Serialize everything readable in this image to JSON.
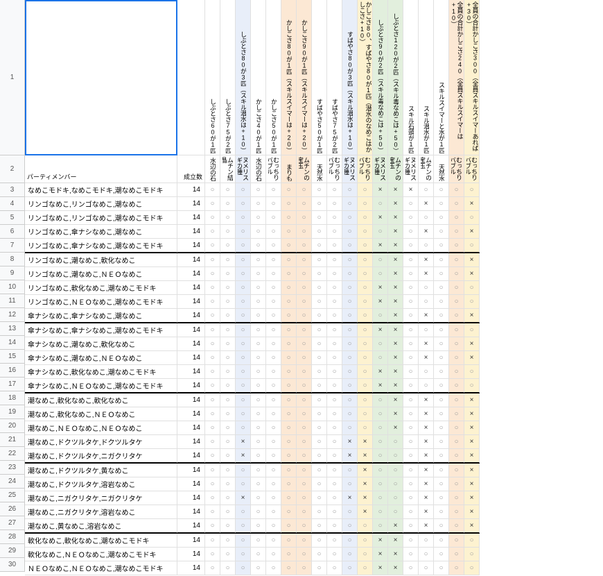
{
  "row1_label": "1",
  "row2_label": "2",
  "headers": [
    {
      "label": "パーティメンバー",
      "w": "w-party",
      "bg": 0
    },
    {
      "label": "成立数",
      "w": "w-count",
      "bg": 0
    },
    {
      "label": "しぶとさ60が1匹",
      "w": "w-s",
      "bg": 0
    },
    {
      "label": "しぶとさ75が2匹",
      "w": "w-s",
      "bg": 0
    },
    {
      "label": "しぶとさ80が3匹（スキル潜水は+10）",
      "w": "w-s",
      "bg": 1
    },
    {
      "label": "かしこさ40が1匹",
      "w": "w-s",
      "bg": 0
    },
    {
      "label": "かしこさ50が1匹",
      "w": "w-s",
      "bg": 0
    },
    {
      "label": "かしこさ80が1匹（スキルスイマーは+20）",
      "w": "w-s",
      "bg": 2
    },
    {
      "label": "かしこさ90が1匹（スキルスイマーは+20）",
      "w": "w-s",
      "bg": 2
    },
    {
      "label": "すばやさ50が1匹",
      "w": "w-s",
      "bg": 0
    },
    {
      "label": "すばやさ75が2匹",
      "w": "w-s",
      "bg": 0
    },
    {
      "label": "すばやさ80が3匹（スキル潜水は+10）",
      "w": "w-s",
      "bg": 1
    },
    {
      "label": "かしこさ80、すばやさ80が1匹（潜水のなめこはかしこさ+10）",
      "w": "w-s",
      "bg": 4
    },
    {
      "label": "しぶとさ90が2匹（スキル毒なめこは+50）",
      "w": "w-s",
      "bg": 3
    },
    {
      "label": "しぶとさ120が2匹（スキル毒なめこは+50）",
      "w": "w-s",
      "bg": 3
    },
    {
      "label": "スキル石頭が1匹",
      "w": "w-s",
      "bg": 0
    },
    {
      "label": "スキル潜水が1匹",
      "w": "w-s",
      "bg": 0
    },
    {
      "label": "スキルスイマーと水が1匹",
      "w": "w-s",
      "bg": 0
    },
    {
      "label": "全員の合計かしこさ240（全員スキルスイマーは+10）",
      "w": "w-s",
      "bg": 2
    },
    {
      "label": "全員の合計かしこさ300（全員スキルスイマーあれば+30）",
      "w": "w-s",
      "bg": 4
    }
  ],
  "headers2": [
    {
      "label": "",
      "w": "w-party",
      "bg": 0
    },
    {
      "label": "",
      "w": "w-count",
      "bg": 0
    },
    {
      "label": "水辺の石",
      "w": "w-s",
      "bg": 0
    },
    {
      "label": "ムチン結晶",
      "w": "w-s",
      "bg": 0
    },
    {
      "label": "ヌメリスギの種",
      "w": "w-s",
      "bg": 1
    },
    {
      "label": "水辺の石",
      "w": "w-s",
      "bg": 0
    },
    {
      "label": "むっちりバブル",
      "w": "w-s",
      "bg": 0
    },
    {
      "label": "まりも",
      "w": "w-s",
      "bg": 2
    },
    {
      "label": "ムチンの宝玉",
      "w": "w-s",
      "bg": 2
    },
    {
      "label": "天然水",
      "w": "w-s",
      "bg": 0
    },
    {
      "label": "むっちりバブル",
      "w": "w-s",
      "bg": 0
    },
    {
      "label": "ヌメリスギの種",
      "w": "w-s",
      "bg": 1
    },
    {
      "label": "むっちりバブル",
      "w": "w-s",
      "bg": 4
    },
    {
      "label": "ヌメリスギの種",
      "w": "w-s",
      "bg": 3
    },
    {
      "label": "ムチンの宝玉",
      "w": "w-s",
      "bg": 3
    },
    {
      "label": "ヌメリスギの種",
      "w": "w-s",
      "bg": 0
    },
    {
      "label": "ムチンの宝玉",
      "w": "w-s",
      "bg": 0
    },
    {
      "label": "天然水",
      "w": "w-s",
      "bg": 0
    },
    {
      "label": "むっちりバブル",
      "w": "w-s",
      "bg": 2
    },
    {
      "label": "むっちりバブル",
      "w": "w-s",
      "bg": 4
    }
  ],
  "rows": [
    {
      "n": 3,
      "p": "なめこモドキ,なめこモドキ,潮なめこモドキ",
      "c": 14,
      "v": [
        "○",
        "○",
        "○",
        "○",
        "○",
        "○",
        "○",
        "○",
        "○",
        "○",
        "○",
        "×",
        "×",
        "×",
        "○",
        "○",
        "○",
        "○"
      ],
      "t": 0
    },
    {
      "n": 4,
      "p": "リンゴなめこ,リンゴなめこ,潮なめこ",
      "c": 14,
      "v": [
        "○",
        "○",
        "○",
        "○",
        "○",
        "○",
        "○",
        "○",
        "○",
        "○",
        "○",
        "○",
        "×",
        "○",
        "×",
        "○",
        "○",
        "×"
      ],
      "t": 0
    },
    {
      "n": 5,
      "p": "リンゴなめこ,リンゴなめこ,潮なめこモドキ",
      "c": 14,
      "v": [
        "○",
        "○",
        "○",
        "○",
        "○",
        "○",
        "○",
        "○",
        "○",
        "○",
        "○",
        "×",
        "×",
        "○",
        "○",
        "○",
        "○",
        "○"
      ],
      "t": 0
    },
    {
      "n": 6,
      "p": "リンゴなめこ,傘ナシなめこ,潮なめこ",
      "c": 14,
      "v": [
        "○",
        "○",
        "○",
        "○",
        "○",
        "○",
        "○",
        "○",
        "○",
        "○",
        "○",
        "○",
        "×",
        "○",
        "×",
        "○",
        "○",
        "×"
      ],
      "t": 0
    },
    {
      "n": 7,
      "p": "リンゴなめこ,傘ナシなめこ,潮なめこモドキ",
      "c": 14,
      "v": [
        "○",
        "○",
        "○",
        "○",
        "○",
        "○",
        "○",
        "○",
        "○",
        "○",
        "○",
        "×",
        "×",
        "○",
        "○",
        "○",
        "○",
        "○"
      ],
      "t": 1
    },
    {
      "n": 8,
      "p": "リンゴなめこ,潮なめこ,軟化なめこ",
      "c": 14,
      "v": [
        "○",
        "○",
        "○",
        "○",
        "○",
        "○",
        "○",
        "○",
        "○",
        "○",
        "○",
        "○",
        "×",
        "○",
        "×",
        "○",
        "○",
        "×"
      ],
      "t": 0
    },
    {
      "n": 9,
      "p": "リンゴなめこ,潮なめこ,ＮＥＯなめこ",
      "c": 14,
      "v": [
        "○",
        "○",
        "○",
        "○",
        "○",
        "○",
        "○",
        "○",
        "○",
        "○",
        "○",
        "○",
        "×",
        "○",
        "×",
        "○",
        "○",
        "×"
      ],
      "t": 0
    },
    {
      "n": 10,
      "p": "リンゴなめこ,軟化なめこ,潮なめこモドキ",
      "c": 14,
      "v": [
        "○",
        "○",
        "○",
        "○",
        "○",
        "○",
        "○",
        "○",
        "○",
        "○",
        "○",
        "×",
        "×",
        "○",
        "○",
        "○",
        "○",
        "○"
      ],
      "t": 0
    },
    {
      "n": 11,
      "p": "リンゴなめこ,ＮＥＯなめこ,潮なめこモドキ",
      "c": 14,
      "v": [
        "○",
        "○",
        "○",
        "○",
        "○",
        "○",
        "○",
        "○",
        "○",
        "○",
        "○",
        "×",
        "×",
        "○",
        "○",
        "○",
        "○",
        "○"
      ],
      "t": 0
    },
    {
      "n": 12,
      "p": "傘ナシなめこ,傘ナシなめこ,潮なめこ",
      "c": 14,
      "v": [
        "○",
        "○",
        "○",
        "○",
        "○",
        "○",
        "○",
        "○",
        "○",
        "○",
        "○",
        "○",
        "×",
        "○",
        "×",
        "○",
        "○",
        "×"
      ],
      "t": 1
    },
    {
      "n": 13,
      "p": "傘ナシなめこ,傘ナシなめこ,潮なめこモドキ",
      "c": 14,
      "v": [
        "○",
        "○",
        "○",
        "○",
        "○",
        "○",
        "○",
        "○",
        "○",
        "○",
        "○",
        "×",
        "×",
        "○",
        "○",
        "○",
        "○",
        "○"
      ],
      "t": 0
    },
    {
      "n": 14,
      "p": "傘ナシなめこ,潮なめこ,軟化なめこ",
      "c": 14,
      "v": [
        "○",
        "○",
        "○",
        "○",
        "○",
        "○",
        "○",
        "○",
        "○",
        "○",
        "○",
        "○",
        "×",
        "○",
        "×",
        "○",
        "○",
        "×"
      ],
      "t": 0
    },
    {
      "n": 15,
      "p": "傘ナシなめこ,潮なめこ,ＮＥＯなめこ",
      "c": 14,
      "v": [
        "○",
        "○",
        "○",
        "○",
        "○",
        "○",
        "○",
        "○",
        "○",
        "○",
        "○",
        "○",
        "×",
        "○",
        "×",
        "○",
        "○",
        "×"
      ],
      "t": 0
    },
    {
      "n": 16,
      "p": "傘ナシなめこ,軟化なめこ,潮なめこモドキ",
      "c": 14,
      "v": [
        "○",
        "○",
        "○",
        "○",
        "○",
        "○",
        "○",
        "○",
        "○",
        "○",
        "○",
        "×",
        "×",
        "○",
        "○",
        "○",
        "○",
        "○"
      ],
      "t": 0
    },
    {
      "n": 17,
      "p": "傘ナシなめこ,ＮＥＯなめこ,潮なめこモドキ",
      "c": 14,
      "v": [
        "○",
        "○",
        "○",
        "○",
        "○",
        "○",
        "○",
        "○",
        "○",
        "○",
        "○",
        "×",
        "×",
        "○",
        "○",
        "○",
        "○",
        "○"
      ],
      "t": 1
    },
    {
      "n": 18,
      "p": "潮なめこ,軟化なめこ,軟化なめこ",
      "c": 14,
      "v": [
        "○",
        "○",
        "○",
        "○",
        "○",
        "○",
        "○",
        "○",
        "○",
        "○",
        "○",
        "○",
        "×",
        "○",
        "×",
        "○",
        "○",
        "×"
      ],
      "t": 0
    },
    {
      "n": 19,
      "p": "潮なめこ,軟化なめこ,ＮＥＯなめこ",
      "c": 14,
      "v": [
        "○",
        "○",
        "○",
        "○",
        "○",
        "○",
        "○",
        "○",
        "○",
        "○",
        "○",
        "○",
        "×",
        "○",
        "×",
        "○",
        "○",
        "×"
      ],
      "t": 0
    },
    {
      "n": 20,
      "p": "潮なめこ,ＮＥＯなめこ,ＮＥＯなめこ",
      "c": 14,
      "v": [
        "○",
        "○",
        "○",
        "○",
        "○",
        "○",
        "○",
        "○",
        "○",
        "○",
        "○",
        "○",
        "×",
        "○",
        "×",
        "○",
        "○",
        "×"
      ],
      "t": 0
    },
    {
      "n": 21,
      "p": "潮なめこ,ドクツルタケ,ドクツルタケ",
      "c": 14,
      "v": [
        "○",
        "○",
        "×",
        "○",
        "○",
        "○",
        "○",
        "○",
        "○",
        "×",
        "×",
        "○",
        "○",
        "○",
        "×",
        "○",
        "○",
        "×"
      ],
      "t": 0
    },
    {
      "n": 22,
      "p": "潮なめこ,ドクツルタケ,ニガクリタケ",
      "c": 14,
      "v": [
        "○",
        "○",
        "×",
        "○",
        "○",
        "○",
        "○",
        "○",
        "○",
        "×",
        "×",
        "○",
        "○",
        "○",
        "×",
        "○",
        "○",
        "×"
      ],
      "t": 1
    },
    {
      "n": 23,
      "p": "潮なめこ,ドクツルタケ,黄なめこ",
      "c": 14,
      "v": [
        "○",
        "○",
        "○",
        "○",
        "○",
        "○",
        "○",
        "○",
        "○",
        "○",
        "×",
        "○",
        "○",
        "○",
        "×",
        "○",
        "○",
        "×"
      ],
      "t": 0
    },
    {
      "n": 24,
      "p": "潮なめこ,ドクツルタケ,溶岩なめこ",
      "c": 14,
      "v": [
        "○",
        "○",
        "○",
        "○",
        "○",
        "○",
        "○",
        "○",
        "○",
        "○",
        "×",
        "○",
        "○",
        "○",
        "×",
        "○",
        "○",
        "×"
      ],
      "t": 0
    },
    {
      "n": 25,
      "p": "潮なめこ,ニガクリタケ,ニガクリタケ",
      "c": 14,
      "v": [
        "○",
        "○",
        "×",
        "○",
        "○",
        "○",
        "○",
        "○",
        "○",
        "×",
        "×",
        "○",
        "○",
        "○",
        "×",
        "○",
        "○",
        "×"
      ],
      "t": 0
    },
    {
      "n": 26,
      "p": "潮なめこ,ニガクリタケ,溶岩なめこ",
      "c": 14,
      "v": [
        "○",
        "○",
        "○",
        "○",
        "○",
        "○",
        "○",
        "○",
        "○",
        "○",
        "×",
        "○",
        "○",
        "○",
        "×",
        "○",
        "○",
        "×"
      ],
      "t": 0
    },
    {
      "n": 27,
      "p": "潮なめこ,黄なめこ,溶岩なめこ",
      "c": 14,
      "v": [
        "○",
        "○",
        "○",
        "○",
        "○",
        "○",
        "○",
        "○",
        "○",
        "○",
        "○",
        "○",
        "×",
        "○",
        "×",
        "○",
        "○",
        "×"
      ],
      "t": 1
    },
    {
      "n": 28,
      "p": "軟化なめこ,軟化なめこ,潮なめこモドキ",
      "c": 14,
      "v": [
        "○",
        "○",
        "○",
        "○",
        "○",
        "○",
        "○",
        "○",
        "○",
        "○",
        "○",
        "×",
        "×",
        "○",
        "○",
        "○",
        "○",
        "○"
      ],
      "t": 0
    },
    {
      "n": 29,
      "p": "軟化なめこ,ＮＥＯなめこ,潮なめこモドキ",
      "c": 14,
      "v": [
        "○",
        "○",
        "○",
        "○",
        "○",
        "○",
        "○",
        "○",
        "○",
        "○",
        "○",
        "×",
        "×",
        "○",
        "○",
        "○",
        "○",
        "○"
      ],
      "t": 0
    },
    {
      "n": 30,
      "p": "ＮＥＯなめこ,ＮＥＯなめこ,潮なめこモドキ",
      "c": 14,
      "v": [
        "○",
        "○",
        "○",
        "○",
        "○",
        "○",
        "○",
        "○",
        "○",
        "○",
        "○",
        "×",
        "×",
        "○",
        "○",
        "○",
        "○",
        "○"
      ],
      "t": 0
    }
  ]
}
